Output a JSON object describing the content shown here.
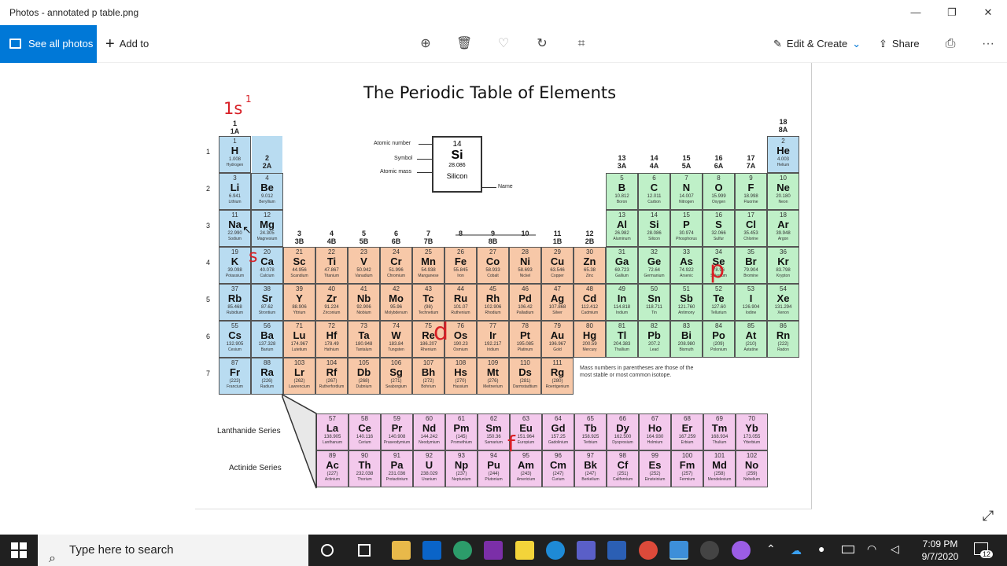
{
  "window": {
    "title": "Photos - annotated p table.png",
    "minimize": "—",
    "restore": "❐",
    "close": "✕"
  },
  "toolbar": {
    "see_all": "See all photos",
    "add_to": "Add to",
    "edit_create": "Edit & Create",
    "share": "Share",
    "more": "···",
    "icons": [
      "zoom-icon",
      "delete-icon",
      "favorite-icon",
      "rotate-icon",
      "crop-icon",
      "print-icon"
    ]
  },
  "image": {
    "title": "The Periodic Table of Elements",
    "annotations": {
      "s1": "1s",
      "s1sup": "1",
      "s": "s",
      "d": "d",
      "p": "p",
      "f": "f"
    },
    "key": {
      "atomic_number_label": "Atomic number",
      "symbol_label": "Symbol",
      "atomic_mass_label": "Atomic mass",
      "name_label": "Name",
      "num": "14",
      "sym": "Si",
      "mass": "28.086",
      "name": "Silicon"
    },
    "groups": [
      {
        "n": "1",
        "a": "1A"
      },
      {
        "n": "2",
        "a": "2A"
      },
      {
        "n": "3",
        "a": "3B"
      },
      {
        "n": "4",
        "a": "4B"
      },
      {
        "n": "5",
        "a": "5B"
      },
      {
        "n": "6",
        "a": "6B"
      },
      {
        "n": "7",
        "a": "7B"
      },
      {
        "n": "8",
        "a": ""
      },
      {
        "n": "9",
        "a": "8B"
      },
      {
        "n": "10",
        "a": ""
      },
      {
        "n": "11",
        "a": "1B"
      },
      {
        "n": "12",
        "a": "2B"
      },
      {
        "n": "13",
        "a": "3A"
      },
      {
        "n": "14",
        "a": "4A"
      },
      {
        "n": "15",
        "a": "5A"
      },
      {
        "n": "16",
        "a": "6A"
      },
      {
        "n": "17",
        "a": "7A"
      },
      {
        "n": "18",
        "a": "8A"
      }
    ],
    "periods": [
      "1",
      "2",
      "3",
      "4",
      "5",
      "6",
      "7"
    ],
    "lanthanide_label": "Lanthanide Series",
    "actinide_label": "Actinide Series",
    "note": "Mass numbers in parentheses are those of the most stable or most common isotope.",
    "elements": [
      {
        "n": "1",
        "s": "H",
        "m": "1.008",
        "nm": "Hydrogen",
        "g": 1,
        "p": 1,
        "b": "s"
      },
      {
        "n": "2",
        "s": "He",
        "m": "4.003",
        "nm": "Helium",
        "g": 18,
        "p": 1,
        "b": "s"
      },
      {
        "n": "3",
        "s": "Li",
        "m": "6.941",
        "nm": "Lithium",
        "g": 1,
        "p": 2,
        "b": "s"
      },
      {
        "n": "4",
        "s": "Be",
        "m": "9.012",
        "nm": "Beryllium",
        "g": 2,
        "p": 2,
        "b": "s"
      },
      {
        "n": "5",
        "s": "B",
        "m": "10.812",
        "nm": "Boron",
        "g": 13,
        "p": 2,
        "b": "p"
      },
      {
        "n": "6",
        "s": "C",
        "m": "12.011",
        "nm": "Carbon",
        "g": 14,
        "p": 2,
        "b": "p"
      },
      {
        "n": "7",
        "s": "N",
        "m": "14.007",
        "nm": "Nitrogen",
        "g": 15,
        "p": 2,
        "b": "p"
      },
      {
        "n": "8",
        "s": "O",
        "m": "15.999",
        "nm": "Oxygen",
        "g": 16,
        "p": 2,
        "b": "p"
      },
      {
        "n": "9",
        "s": "F",
        "m": "18.998",
        "nm": "Fluorine",
        "g": 17,
        "p": 2,
        "b": "p"
      },
      {
        "n": "10",
        "s": "Ne",
        "m": "20.180",
        "nm": "Neon",
        "g": 18,
        "p": 2,
        "b": "p"
      },
      {
        "n": "11",
        "s": "Na",
        "m": "22.990",
        "nm": "Sodium",
        "g": 1,
        "p": 3,
        "b": "s"
      },
      {
        "n": "12",
        "s": "Mg",
        "m": "24.305",
        "nm": "Magnesium",
        "g": 2,
        "p": 3,
        "b": "s"
      },
      {
        "n": "13",
        "s": "Al",
        "m": "26.982",
        "nm": "Aluminum",
        "g": 13,
        "p": 3,
        "b": "p"
      },
      {
        "n": "14",
        "s": "Si",
        "m": "28.086",
        "nm": "Silicon",
        "g": 14,
        "p": 3,
        "b": "p"
      },
      {
        "n": "15",
        "s": "P",
        "m": "30.974",
        "nm": "Phosphorus",
        "g": 15,
        "p": 3,
        "b": "p"
      },
      {
        "n": "16",
        "s": "S",
        "m": "32.066",
        "nm": "Sulfur",
        "g": 16,
        "p": 3,
        "b": "p"
      },
      {
        "n": "17",
        "s": "Cl",
        "m": "35.453",
        "nm": "Chlorine",
        "g": 17,
        "p": 3,
        "b": "p"
      },
      {
        "n": "18",
        "s": "Ar",
        "m": "39.948",
        "nm": "Argon",
        "g": 18,
        "p": 3,
        "b": "p"
      },
      {
        "n": "19",
        "s": "K",
        "m": "39.098",
        "nm": "Potassium",
        "g": 1,
        "p": 4,
        "b": "s"
      },
      {
        "n": "20",
        "s": "Ca",
        "m": "40.078",
        "nm": "Calcium",
        "g": 2,
        "p": 4,
        "b": "s"
      },
      {
        "n": "21",
        "s": "Sc",
        "m": "44.956",
        "nm": "Scandium",
        "g": 3,
        "p": 4,
        "b": "d"
      },
      {
        "n": "22",
        "s": "Ti",
        "m": "47.867",
        "nm": "Titanium",
        "g": 4,
        "p": 4,
        "b": "d"
      },
      {
        "n": "23",
        "s": "V",
        "m": "50.942",
        "nm": "Vanadium",
        "g": 5,
        "p": 4,
        "b": "d"
      },
      {
        "n": "24",
        "s": "Cr",
        "m": "51.996",
        "nm": "Chromium",
        "g": 6,
        "p": 4,
        "b": "d"
      },
      {
        "n": "25",
        "s": "Mn",
        "m": "54.938",
        "nm": "Manganese",
        "g": 7,
        "p": 4,
        "b": "d"
      },
      {
        "n": "26",
        "s": "Fe",
        "m": "55.845",
        "nm": "Iron",
        "g": 8,
        "p": 4,
        "b": "d"
      },
      {
        "n": "27",
        "s": "Co",
        "m": "58.933",
        "nm": "Cobalt",
        "g": 9,
        "p": 4,
        "b": "d"
      },
      {
        "n": "28",
        "s": "Ni",
        "m": "58.693",
        "nm": "Nickel",
        "g": 10,
        "p": 4,
        "b": "d"
      },
      {
        "n": "29",
        "s": "Cu",
        "m": "63.546",
        "nm": "Copper",
        "g": 11,
        "p": 4,
        "b": "d"
      },
      {
        "n": "30",
        "s": "Zn",
        "m": "65.38",
        "nm": "Zinc",
        "g": 12,
        "p": 4,
        "b": "d"
      },
      {
        "n": "31",
        "s": "Ga",
        "m": "69.723",
        "nm": "Gallium",
        "g": 13,
        "p": 4,
        "b": "p"
      },
      {
        "n": "32",
        "s": "Ge",
        "m": "72.64",
        "nm": "Germanium",
        "g": 14,
        "p": 4,
        "b": "p"
      },
      {
        "n": "33",
        "s": "As",
        "m": "74.922",
        "nm": "Arsenic",
        "g": 15,
        "p": 4,
        "b": "p"
      },
      {
        "n": "34",
        "s": "Se",
        "m": "78.96",
        "nm": "Selenium",
        "g": 16,
        "p": 4,
        "b": "p"
      },
      {
        "n": "35",
        "s": "Br",
        "m": "79.904",
        "nm": "Bromine",
        "g": 17,
        "p": 4,
        "b": "p"
      },
      {
        "n": "36",
        "s": "Kr",
        "m": "83.798",
        "nm": "Krypton",
        "g": 18,
        "p": 4,
        "b": "p"
      },
      {
        "n": "37",
        "s": "Rb",
        "m": "85.468",
        "nm": "Rubidium",
        "g": 1,
        "p": 5,
        "b": "s"
      },
      {
        "n": "38",
        "s": "Sr",
        "m": "87.62",
        "nm": "Strontium",
        "g": 2,
        "p": 5,
        "b": "s"
      },
      {
        "n": "39",
        "s": "Y",
        "m": "88.906",
        "nm": "Yttrium",
        "g": 3,
        "p": 5,
        "b": "d"
      },
      {
        "n": "40",
        "s": "Zr",
        "m": "91.224",
        "nm": "Zirconium",
        "g": 4,
        "p": 5,
        "b": "d"
      },
      {
        "n": "41",
        "s": "Nb",
        "m": "92.906",
        "nm": "Niobium",
        "g": 5,
        "p": 5,
        "b": "d"
      },
      {
        "n": "42",
        "s": "Mo",
        "m": "95.96",
        "nm": "Molybdenum",
        "g": 6,
        "p": 5,
        "b": "d"
      },
      {
        "n": "43",
        "s": "Tc",
        "m": "(98)",
        "nm": "Technetium",
        "g": 7,
        "p": 5,
        "b": "d"
      },
      {
        "n": "44",
        "s": "Ru",
        "m": "101.07",
        "nm": "Ruthenium",
        "g": 8,
        "p": 5,
        "b": "d"
      },
      {
        "n": "45",
        "s": "Rh",
        "m": "102.906",
        "nm": "Rhodium",
        "g": 9,
        "p": 5,
        "b": "d"
      },
      {
        "n": "46",
        "s": "Pd",
        "m": "106.42",
        "nm": "Palladium",
        "g": 10,
        "p": 5,
        "b": "d"
      },
      {
        "n": "47",
        "s": "Ag",
        "m": "107.868",
        "nm": "Silver",
        "g": 11,
        "p": 5,
        "b": "d"
      },
      {
        "n": "48",
        "s": "Cd",
        "m": "112.412",
        "nm": "Cadmium",
        "g": 12,
        "p": 5,
        "b": "d"
      },
      {
        "n": "49",
        "s": "In",
        "m": "114.818",
        "nm": "Indium",
        "g": 13,
        "p": 5,
        "b": "p"
      },
      {
        "n": "50",
        "s": "Sn",
        "m": "118.711",
        "nm": "Tin",
        "g": 14,
        "p": 5,
        "b": "p"
      },
      {
        "n": "51",
        "s": "Sb",
        "m": "121.760",
        "nm": "Antimony",
        "g": 15,
        "p": 5,
        "b": "p"
      },
      {
        "n": "52",
        "s": "Te",
        "m": "127.60",
        "nm": "Tellurium",
        "g": 16,
        "p": 5,
        "b": "p"
      },
      {
        "n": "53",
        "s": "I",
        "m": "126.904",
        "nm": "Iodine",
        "g": 17,
        "p": 5,
        "b": "p"
      },
      {
        "n": "54",
        "s": "Xe",
        "m": "131.294",
        "nm": "Xenon",
        "g": 18,
        "p": 5,
        "b": "p"
      },
      {
        "n": "55",
        "s": "Cs",
        "m": "132.905",
        "nm": "Cesium",
        "g": 1,
        "p": 6,
        "b": "s"
      },
      {
        "n": "56",
        "s": "Ba",
        "m": "137.328",
        "nm": "Barium",
        "g": 2,
        "p": 6,
        "b": "s"
      },
      {
        "n": "71",
        "s": "Lu",
        "m": "174.967",
        "nm": "Lutetium",
        "g": 3,
        "p": 6,
        "b": "d"
      },
      {
        "n": "72",
        "s": "Hf",
        "m": "178.49",
        "nm": "Hafnium",
        "g": 4,
        "p": 6,
        "b": "d"
      },
      {
        "n": "73",
        "s": "Ta",
        "m": "180.948",
        "nm": "Tantalum",
        "g": 5,
        "p": 6,
        "b": "d"
      },
      {
        "n": "74",
        "s": "W",
        "m": "183.84",
        "nm": "Tungsten",
        "g": 6,
        "p": 6,
        "b": "d"
      },
      {
        "n": "75",
        "s": "Re",
        "m": "186.207",
        "nm": "Rhenium",
        "g": 7,
        "p": 6,
        "b": "d"
      },
      {
        "n": "76",
        "s": "Os",
        "m": "190.23",
        "nm": "Osmium",
        "g": 8,
        "p": 6,
        "b": "d"
      },
      {
        "n": "77",
        "s": "Ir",
        "m": "192.217",
        "nm": "Iridium",
        "g": 9,
        "p": 6,
        "b": "d"
      },
      {
        "n": "78",
        "s": "Pt",
        "m": "195.085",
        "nm": "Platinum",
        "g": 10,
        "p": 6,
        "b": "d"
      },
      {
        "n": "79",
        "s": "Au",
        "m": "196.967",
        "nm": "Gold",
        "g": 11,
        "p": 6,
        "b": "d"
      },
      {
        "n": "80",
        "s": "Hg",
        "m": "200.59",
        "nm": "Mercury",
        "g": 12,
        "p": 6,
        "b": "d"
      },
      {
        "n": "81",
        "s": "Tl",
        "m": "204.383",
        "nm": "Thallium",
        "g": 13,
        "p": 6,
        "b": "p"
      },
      {
        "n": "82",
        "s": "Pb",
        "m": "207.2",
        "nm": "Lead",
        "g": 14,
        "p": 6,
        "b": "p"
      },
      {
        "n": "83",
        "s": "Bi",
        "m": "208.980",
        "nm": "Bismuth",
        "g": 15,
        "p": 6,
        "b": "p"
      },
      {
        "n": "84",
        "s": "Po",
        "m": "(209)",
        "nm": "Polonium",
        "g": 16,
        "p": 6,
        "b": "p"
      },
      {
        "n": "85",
        "s": "At",
        "m": "(210)",
        "nm": "Astatine",
        "g": 17,
        "p": 6,
        "b": "p"
      },
      {
        "n": "86",
        "s": "Rn",
        "m": "(222)",
        "nm": "Radon",
        "g": 18,
        "p": 6,
        "b": "p"
      },
      {
        "n": "87",
        "s": "Fr",
        "m": "(223)",
        "nm": "Francium",
        "g": 1,
        "p": 7,
        "b": "s"
      },
      {
        "n": "88",
        "s": "Ra",
        "m": "(226)",
        "nm": "Radium",
        "g": 2,
        "p": 7,
        "b": "s"
      },
      {
        "n": "103",
        "s": "Lr",
        "m": "(262)",
        "nm": "Lawrencium",
        "g": 3,
        "p": 7,
        "b": "d"
      },
      {
        "n": "104",
        "s": "Rf",
        "m": "(267)",
        "nm": "Rutherfordium",
        "g": 4,
        "p": 7,
        "b": "d"
      },
      {
        "n": "105",
        "s": "Db",
        "m": "(268)",
        "nm": "Dubnium",
        "g": 5,
        "p": 7,
        "b": "d"
      },
      {
        "n": "106",
        "s": "Sg",
        "m": "(271)",
        "nm": "Seaborgium",
        "g": 6,
        "p": 7,
        "b": "d"
      },
      {
        "n": "107",
        "s": "Bh",
        "m": "(272)",
        "nm": "Bohrium",
        "g": 7,
        "p": 7,
        "b": "d"
      },
      {
        "n": "108",
        "s": "Hs",
        "m": "(270)",
        "nm": "Hassium",
        "g": 8,
        "p": 7,
        "b": "d"
      },
      {
        "n": "109",
        "s": "Mt",
        "m": "(276)",
        "nm": "Meitnerium",
        "g": 9,
        "p": 7,
        "b": "d"
      },
      {
        "n": "110",
        "s": "Ds",
        "m": "(281)",
        "nm": "Darmstadtium",
        "g": 10,
        "p": 7,
        "b": "d"
      },
      {
        "n": "111",
        "s": "Rg",
        "m": "(280)",
        "nm": "Roentgenium",
        "g": 11,
        "p": 7,
        "b": "d"
      }
    ],
    "lanthanides": [
      {
        "n": "57",
        "s": "La",
        "m": "138.905",
        "nm": "Lanthanum"
      },
      {
        "n": "58",
        "s": "Ce",
        "m": "140.116",
        "nm": "Cerium"
      },
      {
        "n": "59",
        "s": "Pr",
        "m": "140.908",
        "nm": "Praseodymium"
      },
      {
        "n": "60",
        "s": "Nd",
        "m": "144.242",
        "nm": "Neodymium"
      },
      {
        "n": "61",
        "s": "Pm",
        "m": "(145)",
        "nm": "Promethium"
      },
      {
        "n": "62",
        "s": "Sm",
        "m": "150.36",
        "nm": "Samarium"
      },
      {
        "n": "63",
        "s": "Eu",
        "m": "151.964",
        "nm": "Europium"
      },
      {
        "n": "64",
        "s": "Gd",
        "m": "157.25",
        "nm": "Gadolinium"
      },
      {
        "n": "65",
        "s": "Tb",
        "m": "158.925",
        "nm": "Terbium"
      },
      {
        "n": "66",
        "s": "Dy",
        "m": "162.500",
        "nm": "Dysprosium"
      },
      {
        "n": "67",
        "s": "Ho",
        "m": "164.930",
        "nm": "Holmium"
      },
      {
        "n": "68",
        "s": "Er",
        "m": "167.259",
        "nm": "Erbium"
      },
      {
        "n": "69",
        "s": "Tm",
        "m": "168.934",
        "nm": "Thulium"
      },
      {
        "n": "70",
        "s": "Yb",
        "m": "173.055",
        "nm": "Ytterbium"
      }
    ],
    "actinides": [
      {
        "n": "89",
        "s": "Ac",
        "m": "(227)",
        "nm": "Actinium"
      },
      {
        "n": "90",
        "s": "Th",
        "m": "232.038",
        "nm": "Thorium"
      },
      {
        "n": "91",
        "s": "Pa",
        "m": "231.036",
        "nm": "Protactinium"
      },
      {
        "n": "92",
        "s": "U",
        "m": "238.029",
        "nm": "Uranium"
      },
      {
        "n": "93",
        "s": "Np",
        "m": "(237)",
        "nm": "Neptunium"
      },
      {
        "n": "94",
        "s": "Pu",
        "m": "(244)",
        "nm": "Plutonium"
      },
      {
        "n": "95",
        "s": "Am",
        "m": "(243)",
        "nm": "Americium"
      },
      {
        "n": "96",
        "s": "Cm",
        "m": "(247)",
        "nm": "Curium"
      },
      {
        "n": "97",
        "s": "Bk",
        "m": "(247)",
        "nm": "Berkelium"
      },
      {
        "n": "98",
        "s": "Cf",
        "m": "(251)",
        "nm": "Californium"
      },
      {
        "n": "99",
        "s": "Es",
        "m": "(252)",
        "nm": "Einsteinium"
      },
      {
        "n": "100",
        "s": "Fm",
        "m": "(257)",
        "nm": "Fermium"
      },
      {
        "n": "101",
        "s": "Md",
        "m": "(258)",
        "nm": "Mendelevium"
      },
      {
        "n": "102",
        "s": "No",
        "m": "(259)",
        "nm": "Nobelium"
      }
    ]
  },
  "taskbar": {
    "search_placeholder": "Type here to search",
    "time": "7:09 PM",
    "date": "9/7/2020",
    "notifications": "12"
  }
}
